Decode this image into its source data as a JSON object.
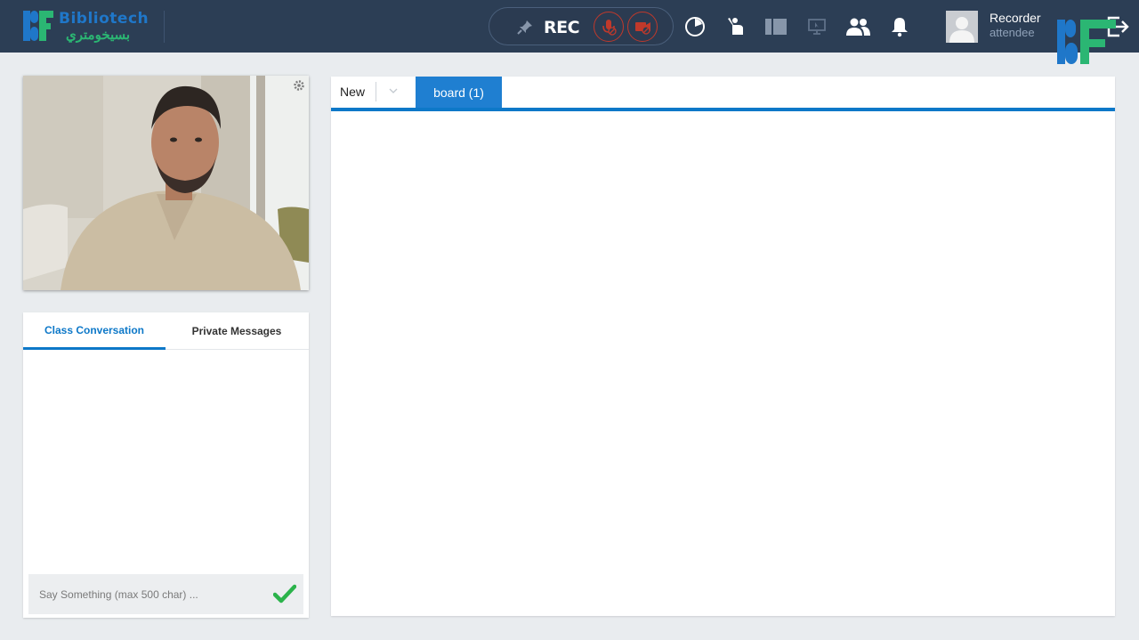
{
  "header": {
    "logo_name": "Bibliotech",
    "logo_subtitle": "بسيخومتري",
    "rec_label": "REC",
    "icons": [
      "pin-icon",
      "mic-off-icon",
      "camera-off-icon",
      "timer-icon",
      "raise-hand-icon",
      "layout-icon",
      "screen-share-icon",
      "users-icon",
      "bell-icon",
      "exit-icon"
    ],
    "user": {
      "name": "Recorder",
      "role": "attendee"
    }
  },
  "chat": {
    "tabs": [
      {
        "label": "Class Conversation",
        "active": true
      },
      {
        "label": "Private Messages",
        "active": false
      }
    ],
    "input_placeholder": "Say Something (max 500 char) ..."
  },
  "board": {
    "new_label": "New",
    "tabs": [
      {
        "label": "board (1)",
        "active": true
      }
    ]
  },
  "colors": {
    "topbar": "#2c3e55",
    "accent": "#0d78c8",
    "rec_off": "#c0392b",
    "send": "#2bb34b",
    "brand_blue": "#1f77c9",
    "brand_green": "#2bb673"
  }
}
